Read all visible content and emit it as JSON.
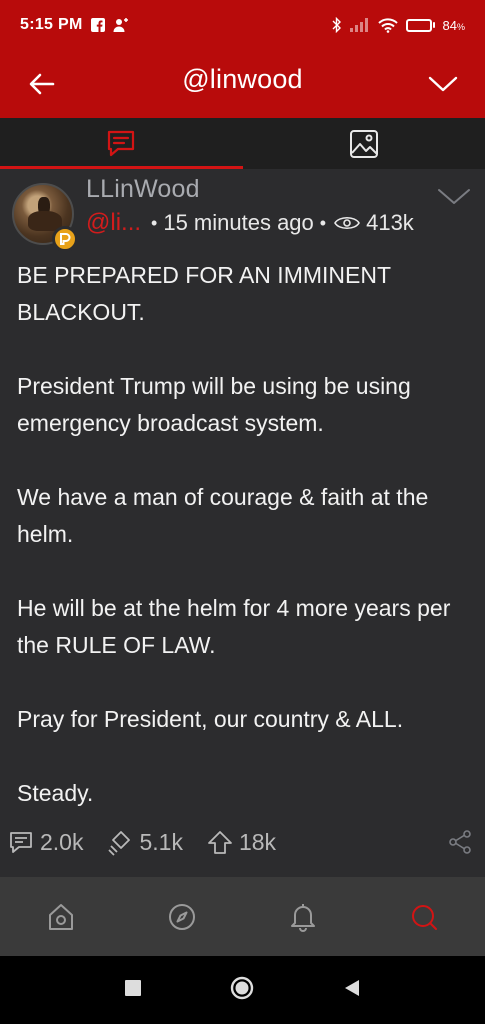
{
  "status_bar": {
    "time": "5:15 PM",
    "battery_text": "84",
    "battery_suffix": "%",
    "battery_level": 0.84,
    "icons": [
      "facebook-icon",
      "add-person-icon",
      "bluetooth-icon",
      "signal-icon",
      "wifi-icon",
      "battery-icon"
    ]
  },
  "header": {
    "title": "@linwood",
    "back_icon": "back-arrow-icon",
    "menu_icon": "chevron-down-icon"
  },
  "tabs": [
    {
      "name": "posts",
      "icon": "post-chat-icon",
      "active": true
    },
    {
      "name": "media",
      "icon": "image-icon",
      "active": false
    }
  ],
  "post": {
    "display_name": "LLinWood",
    "handle": "@li...",
    "time_ago": "15 minutes ago",
    "views": "413k",
    "paragraphs": [
      "BE PREPARED FOR AN IMMINENT BLACKOUT.",
      "President Trump will be using be using emergency broadcast system.",
      "We have a man of courage & faith at the helm.",
      "He will be at the helm for 4 more years per the RULE OF LAW.",
      "Pray for President, our country & ALL.",
      "Steady."
    ],
    "actions": {
      "comments": "2.0k",
      "reposts": "5.1k",
      "upvotes": "18k"
    }
  },
  "colors": {
    "brand_red": "#b80b0b",
    "accent_red": "#d21414",
    "background": "#2c2c2e",
    "badge_gold": "#e8a21a"
  },
  "bottom_nav": [
    {
      "name": "home",
      "icon": "home-icon"
    },
    {
      "name": "explore",
      "icon": "compass-icon"
    },
    {
      "name": "notifications",
      "icon": "bell-icon"
    },
    {
      "name": "search",
      "icon": "search-icon"
    }
  ]
}
